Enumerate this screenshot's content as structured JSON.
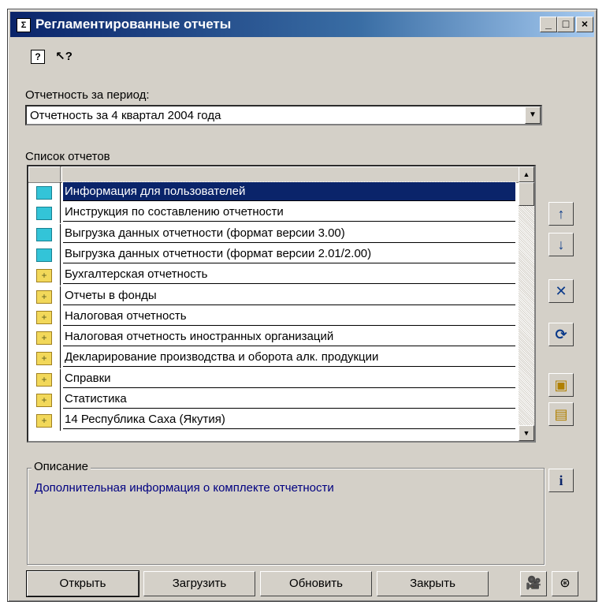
{
  "window": {
    "title": "Регламентированные отчеты",
    "title_icon": "report-icon",
    "minimize": "_",
    "maximize": "□",
    "close": "×"
  },
  "toolbar": {
    "help_icon": "?",
    "whatsthis_icon": "↖?"
  },
  "period": {
    "label": "Отчетность за период:",
    "value": "Отчетность за 4 квартал 2004 года"
  },
  "reports": {
    "label": "Список отчетов",
    "items": [
      {
        "label": "Информация для пользователей",
        "type": "folder-cyan"
      },
      {
        "label": "Инструкция по составлению отчетности",
        "type": "folder-cyan"
      },
      {
        "label": "Выгрузка данных отчетности (формат версии 3.00)",
        "type": "folder-cyan"
      },
      {
        "label": "Выгрузка данных отчетности (формат версии 2.01/2.00)",
        "type": "folder-cyan"
      },
      {
        "label": "Бухгалтерская отчетность",
        "type": "folder-yellow-plus"
      },
      {
        "label": "Отчеты в фонды",
        "type": "folder-yellow-plus"
      },
      {
        "label": "Налоговая отчетность",
        "type": "folder-yellow-plus"
      },
      {
        "label": "Налоговая отчетность иностранных организаций",
        "type": "folder-yellow-plus"
      },
      {
        "label": "Декларирование производства и оборота алк. продукции",
        "type": "folder-yellow-plus"
      },
      {
        "label": "Справки",
        "type": "folder-yellow-plus"
      },
      {
        "label": "Статистика",
        "type": "folder-yellow-plus"
      },
      {
        "label": "14 Республика Саха (Якутия)",
        "type": "folder-yellow-plus"
      }
    ]
  },
  "description": {
    "legend": "Описание",
    "text": "Дополнительная информация о комплекте отчетности"
  },
  "buttons": {
    "open": "Открыть",
    "load": "Загрузить",
    "refresh": "Обновить",
    "close": "Закрыть"
  },
  "colors": {
    "face": "#d4d0c8",
    "selection": "#0a246a",
    "title_start": "#0a246a",
    "desc_text": "#000080"
  }
}
